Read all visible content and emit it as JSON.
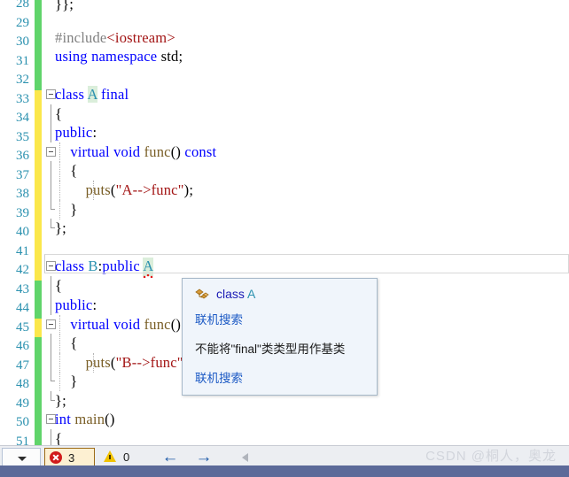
{
  "editor": {
    "language": "C++",
    "first_visible_line": 28,
    "lines": [
      {
        "num": 28,
        "change": "green",
        "text": "}};",
        "clipped_top": true
      },
      {
        "num": 29,
        "change": "green",
        "text": ""
      },
      {
        "num": 30,
        "change": "green",
        "text": "#include<iostream>"
      },
      {
        "num": 31,
        "change": "green",
        "text": "using namespace std;"
      },
      {
        "num": 32,
        "change": "green",
        "text": ""
      },
      {
        "num": 33,
        "change": "yellow",
        "text": "class A final"
      },
      {
        "num": 34,
        "change": "yellow",
        "text": "{"
      },
      {
        "num": 35,
        "change": "yellow",
        "text": "public:"
      },
      {
        "num": 36,
        "change": "yellow",
        "text": "    virtual void func() const"
      },
      {
        "num": 37,
        "change": "yellow",
        "text": "    {"
      },
      {
        "num": 38,
        "change": "yellow",
        "text": "        puts(\"A-->func\");"
      },
      {
        "num": 39,
        "change": "yellow",
        "text": "    }"
      },
      {
        "num": 40,
        "change": "yellow",
        "text": "};"
      },
      {
        "num": 41,
        "change": "yellow",
        "text": ""
      },
      {
        "num": 42,
        "change": "yellow",
        "text": "class B:public A"
      },
      {
        "num": 43,
        "change": "green",
        "text": "{"
      },
      {
        "num": 44,
        "change": "green",
        "text": "public:"
      },
      {
        "num": 45,
        "change": "yellow",
        "text": "    virtual void func() const"
      },
      {
        "num": 46,
        "change": "green",
        "text": "    {"
      },
      {
        "num": 47,
        "change": "green",
        "text": "        puts(\"B-->func\");"
      },
      {
        "num": 48,
        "change": "green",
        "text": "    }"
      },
      {
        "num": 49,
        "change": "green",
        "text": "};"
      },
      {
        "num": 50,
        "change": "green",
        "text": "int main()"
      },
      {
        "num": 51,
        "change": "green",
        "text": "{"
      }
    ],
    "highlighted_symbol": "A",
    "error_symbol": "A"
  },
  "tooltip": {
    "icon": "class-icon",
    "signature_keyword": "class",
    "signature_name": "A",
    "search_link_top": "联机搜索",
    "message": "不能将\"final\"类类型用作基类",
    "search_link_bottom": "联机搜索"
  },
  "statusbar": {
    "scope_selector_value": "",
    "error_count": "3",
    "warning_count": "0",
    "nav_back_glyph": "←",
    "nav_forward_glyph": "→"
  },
  "watermark": {
    "text": "CSDN @桐人，奥龙"
  },
  "colors": {
    "keyword": "#0000ff",
    "type": "#2b91af",
    "string": "#a31515",
    "preprocessor": "#808080",
    "function": "#795e26",
    "changebar_saved": "#60d46a",
    "changebar_unsaved": "#fbe74b",
    "error_red": "#d11b1b",
    "warning_yellow": "#f2c200",
    "tooltip_bg": "#f0f5fb",
    "bottombar": "#5c6a99"
  }
}
